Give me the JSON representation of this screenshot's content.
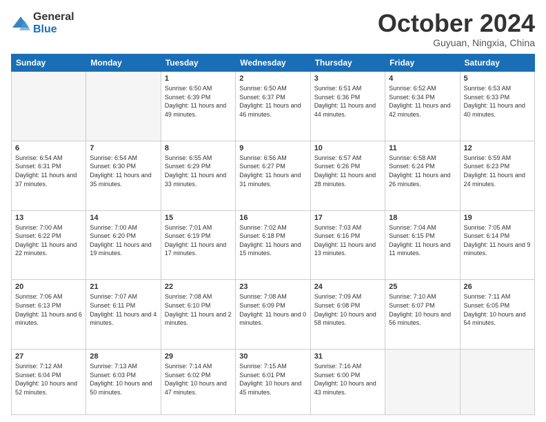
{
  "logo": {
    "general": "General",
    "blue": "Blue"
  },
  "title": "October 2024",
  "subtitle": "Guyuan, Ningxia, China",
  "days_of_week": [
    "Sunday",
    "Monday",
    "Tuesday",
    "Wednesday",
    "Thursday",
    "Friday",
    "Saturday"
  ],
  "weeks": [
    [
      {
        "day": null,
        "sunrise": null,
        "sunset": null,
        "daylight": null
      },
      {
        "day": null,
        "sunrise": null,
        "sunset": null,
        "daylight": null
      },
      {
        "day": "1",
        "sunrise": "Sunrise: 6:50 AM",
        "sunset": "Sunset: 6:39 PM",
        "daylight": "Daylight: 11 hours and 49 minutes."
      },
      {
        "day": "2",
        "sunrise": "Sunrise: 6:50 AM",
        "sunset": "Sunset: 6:37 PM",
        "daylight": "Daylight: 11 hours and 46 minutes."
      },
      {
        "day": "3",
        "sunrise": "Sunrise: 6:51 AM",
        "sunset": "Sunset: 6:36 PM",
        "daylight": "Daylight: 11 hours and 44 minutes."
      },
      {
        "day": "4",
        "sunrise": "Sunrise: 6:52 AM",
        "sunset": "Sunset: 6:34 PM",
        "daylight": "Daylight: 11 hours and 42 minutes."
      },
      {
        "day": "5",
        "sunrise": "Sunrise: 6:53 AM",
        "sunset": "Sunset: 6:33 PM",
        "daylight": "Daylight: 11 hours and 40 minutes."
      }
    ],
    [
      {
        "day": "6",
        "sunrise": "Sunrise: 6:54 AM",
        "sunset": "Sunset: 6:31 PM",
        "daylight": "Daylight: 11 hours and 37 minutes."
      },
      {
        "day": "7",
        "sunrise": "Sunrise: 6:54 AM",
        "sunset": "Sunset: 6:30 PM",
        "daylight": "Daylight: 11 hours and 35 minutes."
      },
      {
        "day": "8",
        "sunrise": "Sunrise: 6:55 AM",
        "sunset": "Sunset: 6:29 PM",
        "daylight": "Daylight: 11 hours and 33 minutes."
      },
      {
        "day": "9",
        "sunrise": "Sunrise: 6:56 AM",
        "sunset": "Sunset: 6:27 PM",
        "daylight": "Daylight: 11 hours and 31 minutes."
      },
      {
        "day": "10",
        "sunrise": "Sunrise: 6:57 AM",
        "sunset": "Sunset: 6:26 PM",
        "daylight": "Daylight: 11 hours and 28 minutes."
      },
      {
        "day": "11",
        "sunrise": "Sunrise: 6:58 AM",
        "sunset": "Sunset: 6:24 PM",
        "daylight": "Daylight: 11 hours and 26 minutes."
      },
      {
        "day": "12",
        "sunrise": "Sunrise: 6:59 AM",
        "sunset": "Sunset: 6:23 PM",
        "daylight": "Daylight: 11 hours and 24 minutes."
      }
    ],
    [
      {
        "day": "13",
        "sunrise": "Sunrise: 7:00 AM",
        "sunset": "Sunset: 6:22 PM",
        "daylight": "Daylight: 11 hours and 22 minutes."
      },
      {
        "day": "14",
        "sunrise": "Sunrise: 7:00 AM",
        "sunset": "Sunset: 6:20 PM",
        "daylight": "Daylight: 11 hours and 19 minutes."
      },
      {
        "day": "15",
        "sunrise": "Sunrise: 7:01 AM",
        "sunset": "Sunset: 6:19 PM",
        "daylight": "Daylight: 11 hours and 17 minutes."
      },
      {
        "day": "16",
        "sunrise": "Sunrise: 7:02 AM",
        "sunset": "Sunset: 6:18 PM",
        "daylight": "Daylight: 11 hours and 15 minutes."
      },
      {
        "day": "17",
        "sunrise": "Sunrise: 7:03 AM",
        "sunset": "Sunset: 6:16 PM",
        "daylight": "Daylight: 11 hours and 13 minutes."
      },
      {
        "day": "18",
        "sunrise": "Sunrise: 7:04 AM",
        "sunset": "Sunset: 6:15 PM",
        "daylight": "Daylight: 11 hours and 11 minutes."
      },
      {
        "day": "19",
        "sunrise": "Sunrise: 7:05 AM",
        "sunset": "Sunset: 6:14 PM",
        "daylight": "Daylight: 11 hours and 9 minutes."
      }
    ],
    [
      {
        "day": "20",
        "sunrise": "Sunrise: 7:06 AM",
        "sunset": "Sunset: 6:13 PM",
        "daylight": "Daylight: 11 hours and 6 minutes."
      },
      {
        "day": "21",
        "sunrise": "Sunrise: 7:07 AM",
        "sunset": "Sunset: 6:11 PM",
        "daylight": "Daylight: 11 hours and 4 minutes."
      },
      {
        "day": "22",
        "sunrise": "Sunrise: 7:08 AM",
        "sunset": "Sunset: 6:10 PM",
        "daylight": "Daylight: 11 hours and 2 minutes."
      },
      {
        "day": "23",
        "sunrise": "Sunrise: 7:08 AM",
        "sunset": "Sunset: 6:09 PM",
        "daylight": "Daylight: 11 hours and 0 minutes."
      },
      {
        "day": "24",
        "sunrise": "Sunrise: 7:09 AM",
        "sunset": "Sunset: 6:08 PM",
        "daylight": "Daylight: 10 hours and 58 minutes."
      },
      {
        "day": "25",
        "sunrise": "Sunrise: 7:10 AM",
        "sunset": "Sunset: 6:07 PM",
        "daylight": "Daylight: 10 hours and 56 minutes."
      },
      {
        "day": "26",
        "sunrise": "Sunrise: 7:11 AM",
        "sunset": "Sunset: 6:05 PM",
        "daylight": "Daylight: 10 hours and 54 minutes."
      }
    ],
    [
      {
        "day": "27",
        "sunrise": "Sunrise: 7:12 AM",
        "sunset": "Sunset: 6:04 PM",
        "daylight": "Daylight: 10 hours and 52 minutes."
      },
      {
        "day": "28",
        "sunrise": "Sunrise: 7:13 AM",
        "sunset": "Sunset: 6:03 PM",
        "daylight": "Daylight: 10 hours and 50 minutes."
      },
      {
        "day": "29",
        "sunrise": "Sunrise: 7:14 AM",
        "sunset": "Sunset: 6:02 PM",
        "daylight": "Daylight: 10 hours and 47 minutes."
      },
      {
        "day": "30",
        "sunrise": "Sunrise: 7:15 AM",
        "sunset": "Sunset: 6:01 PM",
        "daylight": "Daylight: 10 hours and 45 minutes."
      },
      {
        "day": "31",
        "sunrise": "Sunrise: 7:16 AM",
        "sunset": "Sunset: 6:00 PM",
        "daylight": "Daylight: 10 hours and 43 minutes."
      },
      {
        "day": null,
        "sunrise": null,
        "sunset": null,
        "daylight": null
      },
      {
        "day": null,
        "sunrise": null,
        "sunset": null,
        "daylight": null
      }
    ]
  ]
}
